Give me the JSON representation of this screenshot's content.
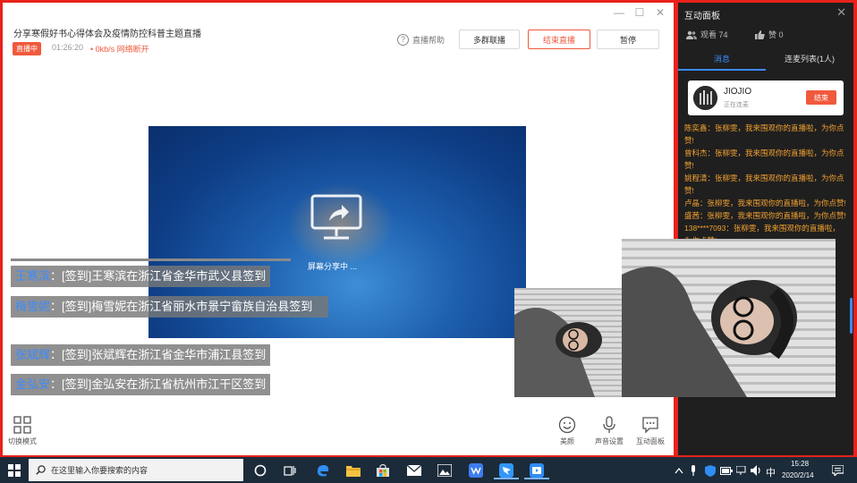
{
  "live": {
    "title": "分享寒假好书心得体会及疫情防控科普主题直播",
    "status_badge": "直播中",
    "timer": "01:26:20",
    "network": "• 0kb/s 网络断开",
    "help": "直播帮助",
    "buttons": {
      "multi": "多群联播",
      "end": "结束直播",
      "pause": "暂停"
    },
    "share_text": "屏幕分享中 ..."
  },
  "chat": [
    {
      "name": "王寒滨",
      "text": "：[签到]王寒滨在浙江省金华市武义县签到"
    },
    {
      "name": "梅雪妮",
      "text": "：[签到]梅雪妮在浙江省丽水市景宁畲族自治县签到"
    },
    {
      "name": "张斌辉",
      "text": "：[签到]张斌辉在浙江省金华市浦江县签到"
    },
    {
      "name": "金弘安",
      "text": "：[签到]金弘安在浙江省杭州市江干区签到"
    }
  ],
  "bottom_bar": {
    "switch_mode": "切换模式",
    "beauty": "美颜",
    "audio": "声音设置",
    "interact": "互动面板"
  },
  "panel": {
    "title": "互动面板",
    "views": "观看 74",
    "likes": "赞 0",
    "tab_messages": "消息",
    "tab_mic_list": "连麦列表(1人)",
    "mic_user": {
      "name": "JIOJIO",
      "status": "正在连麦",
      "end_label": "结束"
    },
    "messages": [
      "陈奕鑫：张柳雯，我来围观你的直播啦，为你点赞!",
      "曾科杰：张柳雯，我来围观你的直播啦，为你点赞!",
      "姚程清：张柳雯，我来围观你的直播啦，为你点赞!",
      "卢晶：张柳雯，我来围观你的直播啦，为你点赞!",
      "盛茜：张柳雯，我来围观你的直播啦，为你点赞!",
      "138****7093：张柳雯，我来围观你的直播啦，为你点赞!"
    ]
  },
  "taskbar": {
    "search_placeholder": "在这里输入你要搜索的内容",
    "ime": "中",
    "time": "15:28",
    "date": "2020/2/14"
  },
  "colors": {
    "accent": "#f05a3c",
    "link_blue": "#3b8bff",
    "panel_bg": "#1f1f1f",
    "taskbar_bg": "#1c2b3a"
  }
}
